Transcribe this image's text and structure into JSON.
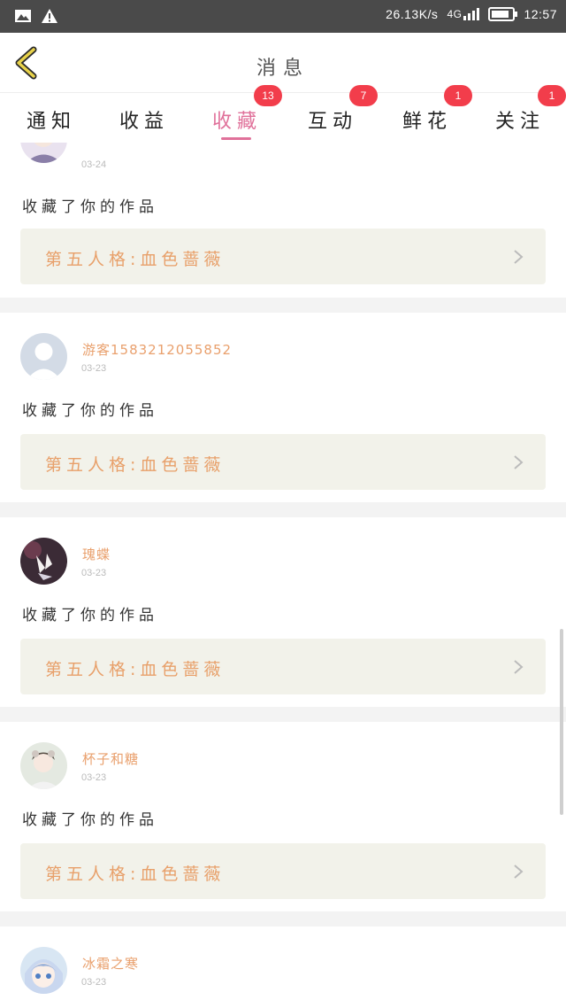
{
  "status_bar": {
    "speed": "26.13K/s",
    "network": "4G",
    "time": "12:57",
    "battery_level": 0.85,
    "icons": [
      "image-icon",
      "warning-icon",
      "signal-icon",
      "battery-icon"
    ]
  },
  "header": {
    "title": "消息",
    "back_icon": "chevron-left-icon"
  },
  "tabs": [
    {
      "label": "通知",
      "badge": ""
    },
    {
      "label": "收益",
      "badge": ""
    },
    {
      "label": "收藏",
      "badge": "13",
      "active": true
    },
    {
      "label": "互动",
      "badge": "7"
    },
    {
      "label": "鲜花",
      "badge": "1"
    },
    {
      "label": "关注",
      "badge": "1"
    }
  ],
  "items": [
    {
      "name": "",
      "date": "03-24",
      "action": "收藏了你的作品",
      "work": "第五人格:血色蔷薇",
      "avatar": "avatar-anime-1"
    },
    {
      "name": "游客1583212055852",
      "date": "03-23",
      "action": "收藏了你的作品",
      "work": "第五人格:血色蔷薇",
      "avatar": "avatar-default"
    },
    {
      "name": "瑰蝶",
      "date": "03-23",
      "action": "收藏了你的作品",
      "work": "第五人格:血色蔷薇",
      "avatar": "avatar-butterfly"
    },
    {
      "name": "杯子和糖",
      "date": "03-23",
      "action": "收藏了你的作品",
      "work": "第五人格:血色蔷薇",
      "avatar": "avatar-girl"
    },
    {
      "name": "冰霜之寒",
      "date": "03-23",
      "action": "",
      "work": "",
      "avatar": "avatar-anime-2"
    }
  ],
  "colors": {
    "accent": "#e0719a",
    "badge": "#f23d4b",
    "username": "#e9a06d",
    "work_bg": "#f2f2ea",
    "work_text": "#e8a06a",
    "status_bar_bg": "#4a4a4a"
  }
}
